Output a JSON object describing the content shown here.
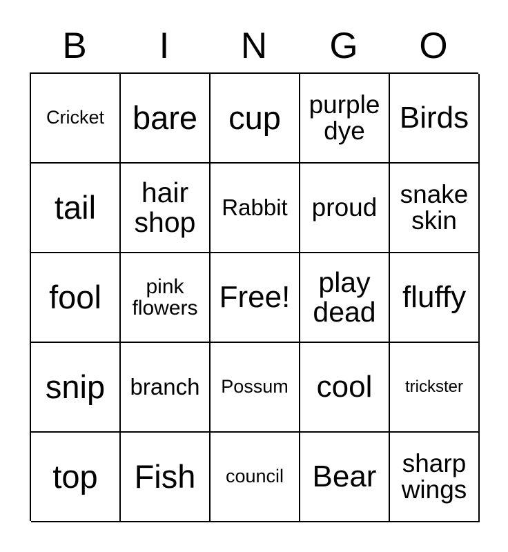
{
  "card": {
    "header_letters": [
      "B",
      "I",
      "N",
      "G",
      "O"
    ],
    "columns": 5,
    "rows": 5,
    "free_space_label": "Free!",
    "free_space_position": {
      "row": 3,
      "column": 3
    },
    "colors": {
      "background": "#ffffff",
      "text": "#000000",
      "grid_line": "#000000"
    },
    "rows_data": [
      {
        "cells": [
          {
            "text": "Cricket",
            "size": "xxs"
          },
          {
            "text": "bare",
            "size": "xxl"
          },
          {
            "text": "cup",
            "size": "xxl"
          },
          {
            "text": "purple dye",
            "size": "md",
            "lines": 2
          },
          {
            "text": "Birds",
            "size": "xl"
          }
        ]
      },
      {
        "cells": [
          {
            "text": "tail",
            "size": "xxl"
          },
          {
            "text": "hair shop",
            "size": "lg",
            "lines": 2
          },
          {
            "text": "Rabbit",
            "size": "sm"
          },
          {
            "text": "proud",
            "size": "md"
          },
          {
            "text": "snake skin",
            "size": "md",
            "lines": 2
          }
        ]
      },
      {
        "cells": [
          {
            "text": "fool",
            "size": "xxl"
          },
          {
            "text": "pink flowers",
            "size": "xs",
            "lines": 2
          },
          {
            "text": "Free!",
            "size": "xl"
          },
          {
            "text": "play dead",
            "size": "lg",
            "lines": 2
          },
          {
            "text": "fluffy",
            "size": "xl"
          }
        ]
      },
      {
        "cells": [
          {
            "text": "snip",
            "size": "xxl"
          },
          {
            "text": "branch",
            "size": "sm"
          },
          {
            "text": "Possum",
            "size": "xxs"
          },
          {
            "text": "cool",
            "size": "xl"
          },
          {
            "text": "trickster",
            "size": "tiny"
          }
        ]
      },
      {
        "cells": [
          {
            "text": "top",
            "size": "xxl"
          },
          {
            "text": "Fish",
            "size": "xxl"
          },
          {
            "text": "council",
            "size": "xxs"
          },
          {
            "text": "Bear",
            "size": "xl"
          },
          {
            "text": "sharp wings",
            "size": "md",
            "lines": 2
          }
        ]
      }
    ]
  }
}
